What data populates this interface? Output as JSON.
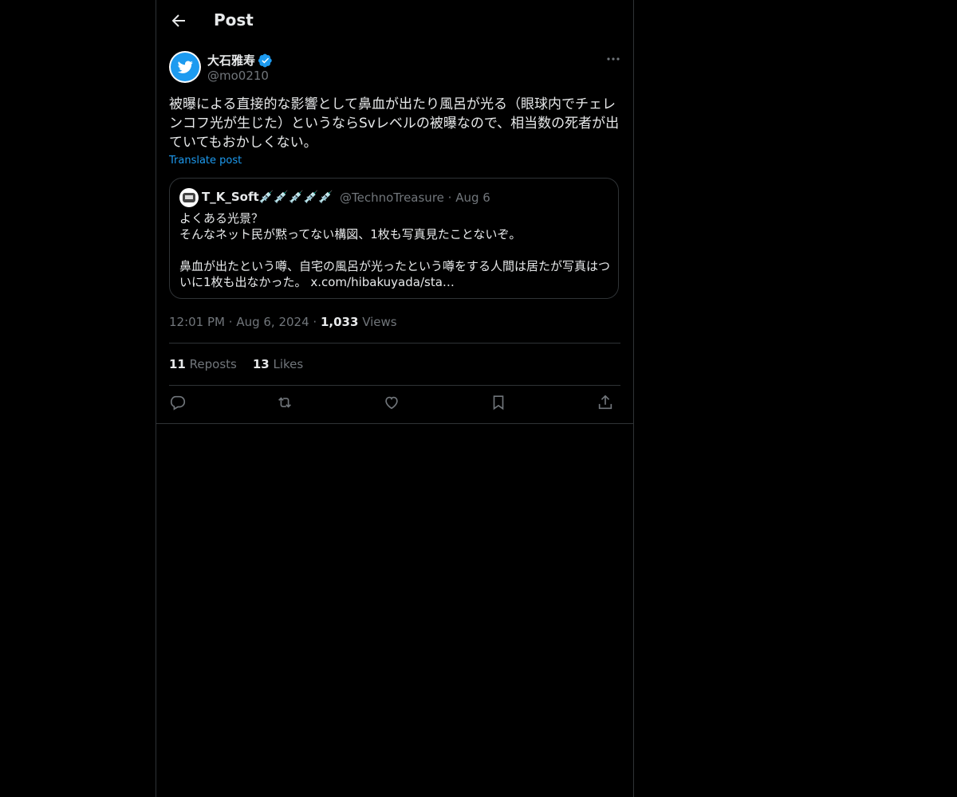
{
  "header": {
    "title": "Post",
    "back_icon": "arrow-left-icon"
  },
  "post": {
    "author_name": "大石雅寿",
    "author_handle": "@mo0210",
    "verified_icon": "verified-badge-icon",
    "avatar_icon": "twitter-bird-icon",
    "text": "被曝による直接的な影響として鼻血が出たり風呂が光る（眼球内でチェレンコフ光が生じた）というならSvレベルの被曝なので、相当数の死者が出ていてもおかしくない。",
    "translate_label": "Translate post",
    "time": "12:01 PM",
    "date": "Aug 6, 2024",
    "views_count": "1,033",
    "views_label": "Views",
    "reposts_count": "11",
    "reposts_label": "Reposts",
    "likes_count": "13",
    "likes_label": "Likes"
  },
  "quote": {
    "author_name": "T_K_Soft💉💉💉💉💉",
    "author_handle": "@TechnoTreasure",
    "date": "Aug 6",
    "text": "よくある光景？\nそんなネット民が黙ってない構図、1枚も写真見たことないぞ。\n\n鼻血が出たという噂、自宅の風呂が光ったという噂をする人間は居たが写真はついに1枚も出なかった。 ",
    "link": "x.com/hibakuyada/sta…"
  },
  "colors": {
    "accent": "#1d9bf0",
    "muted": "#71767b",
    "text": "#e7e9ea",
    "border": "#2f3336"
  },
  "actions": [
    "reply-icon",
    "repost-icon",
    "like-icon",
    "bookmark-icon",
    "share-icon"
  ]
}
